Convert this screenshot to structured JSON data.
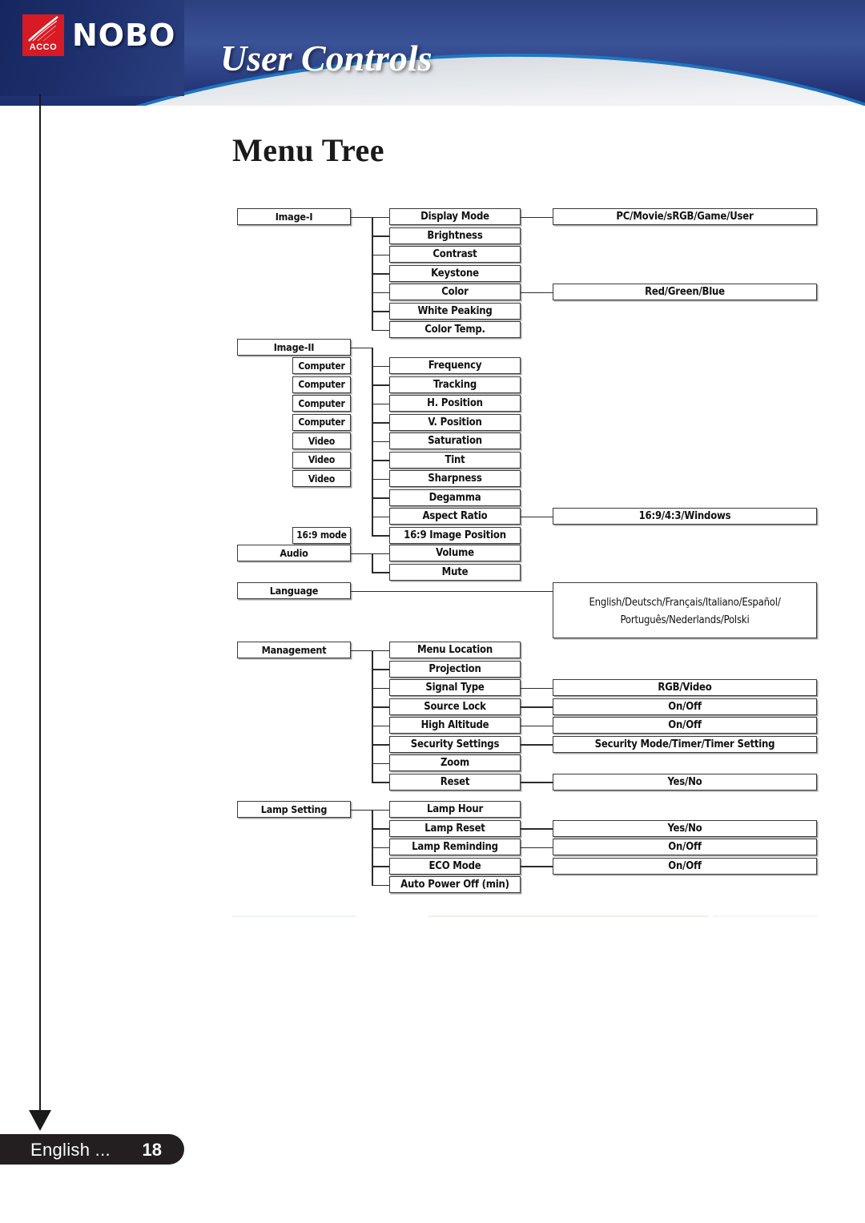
{
  "header": {
    "brand": "NOBO",
    "brand_sub": "ACCO",
    "title": "User Controls"
  },
  "section": {
    "heading": "Menu Tree"
  },
  "footer": {
    "language_label": "English ...",
    "page_number": "18"
  },
  "tree": {
    "groups": [
      {
        "name": "Image-I",
        "items": [
          {
            "label": "Display Mode",
            "source": "",
            "values": "PC/Movie/sRGB/Game/User"
          },
          {
            "label": "Brightness",
            "source": "",
            "values": ""
          },
          {
            "label": "Contrast",
            "source": "",
            "values": ""
          },
          {
            "label": "Keystone",
            "source": "",
            "values": ""
          },
          {
            "label": "Color",
            "source": "",
            "values": "Red/Green/Blue"
          },
          {
            "label": "White Peaking",
            "source": "",
            "values": ""
          },
          {
            "label": "Color Temp.",
            "source": "",
            "values": ""
          }
        ]
      },
      {
        "name": "Image-II",
        "items": [
          {
            "label": "Frequency",
            "source": "Computer",
            "values": ""
          },
          {
            "label": "Tracking",
            "source": "Computer",
            "values": ""
          },
          {
            "label": "H. Position",
            "source": "Computer",
            "values": ""
          },
          {
            "label": "V. Position",
            "source": "Computer",
            "values": ""
          },
          {
            "label": "Saturation",
            "source": "Video",
            "values": ""
          },
          {
            "label": "Tint",
            "source": "Video",
            "values": ""
          },
          {
            "label": "Sharpness",
            "source": "Video",
            "values": ""
          },
          {
            "label": "Degamma",
            "source": "",
            "values": ""
          },
          {
            "label": "Aspect Ratio",
            "source": "",
            "values": "16:9/4:3/Windows"
          },
          {
            "label": "16:9 Image Position",
            "source": "16:9 mode",
            "values": ""
          }
        ]
      },
      {
        "name": "Audio",
        "items": [
          {
            "label": "Volume",
            "source": "",
            "values": ""
          },
          {
            "label": "Mute",
            "source": "",
            "values": ""
          }
        ]
      },
      {
        "name": "Language",
        "items": [],
        "values": "English/Deutsch/Français/Italiano/Español/ Português/Nederlands/Polski",
        "values_line1": "English/Deutsch/Français/Italiano/Español/",
        "values_line2": "Português/Nederlands/Polski"
      },
      {
        "name": "Management",
        "items": [
          {
            "label": "Menu Location",
            "source": "",
            "values": ""
          },
          {
            "label": "Projection",
            "source": "",
            "values": ""
          },
          {
            "label": "Signal Type",
            "source": "",
            "values": "RGB/Video"
          },
          {
            "label": "Source Lock",
            "source": "",
            "values": "On/Off"
          },
          {
            "label": "High Altitude",
            "source": "",
            "values": "On/Off"
          },
          {
            "label": "Security Settings",
            "source": "",
            "values": "Security Mode/Timer/Timer Setting"
          },
          {
            "label": "Zoom",
            "source": "",
            "values": ""
          },
          {
            "label": "Reset",
            "source": "",
            "values": "Yes/No"
          }
        ]
      },
      {
        "name": "Lamp Setting",
        "items": [
          {
            "label": "Lamp Hour",
            "source": "",
            "values": ""
          },
          {
            "label": "Lamp Reset",
            "source": "",
            "values": "Yes/No"
          },
          {
            "label": "Lamp Reminding",
            "source": "",
            "values": "On/Off"
          },
          {
            "label": "ECO Mode",
            "source": "",
            "values": "On/Off"
          },
          {
            "label": "Auto Power Off (min)",
            "source": "",
            "values": ""
          }
        ]
      }
    ]
  },
  "colors": {
    "banner_blue": "#33498c",
    "banner_accent": "#1d78c4",
    "logo_red": "#d71a24",
    "footer_dark": "#231f20",
    "node_border": "#3a3a3a"
  }
}
